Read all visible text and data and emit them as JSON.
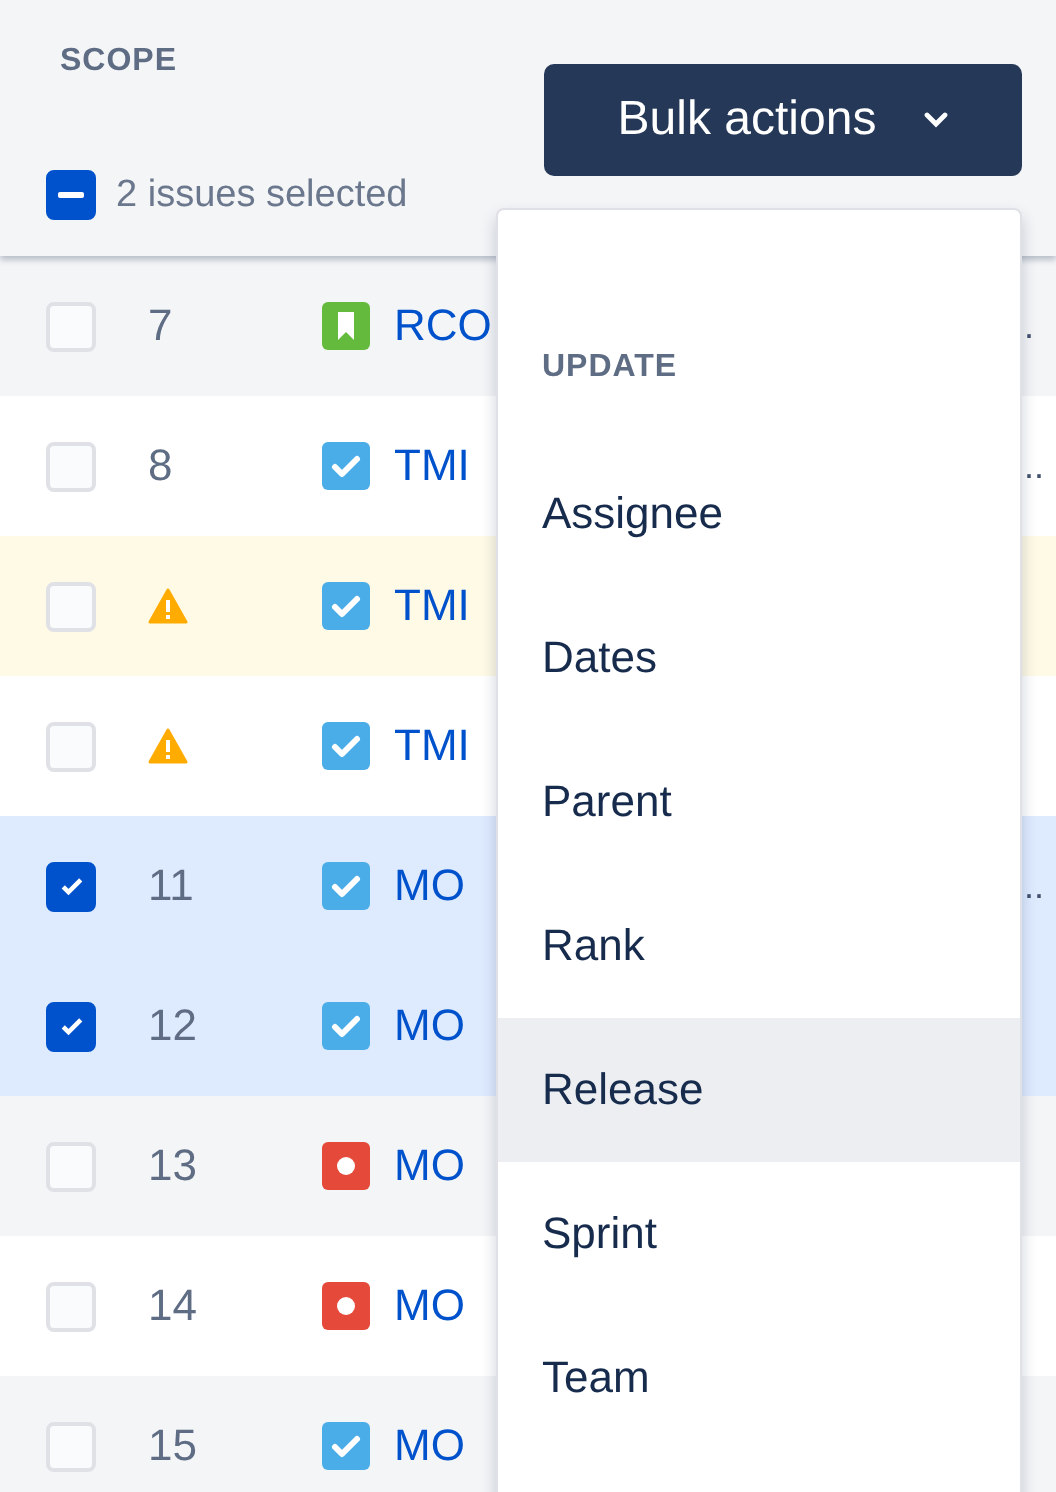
{
  "header": {
    "title": "SCOPE",
    "selection": {
      "label": "2 issues selected",
      "indeterminate": true
    },
    "bulk_button": {
      "label": "Bulk actions"
    }
  },
  "rows": [
    {
      "checked": false,
      "number": "7",
      "warning": false,
      "kind": "story",
      "key": "RCO",
      "highlighted": false,
      "overflow": "."
    },
    {
      "checked": false,
      "number": "8",
      "warning": false,
      "kind": "task",
      "key": "TMI",
      "highlighted": false,
      "overflow": ".."
    },
    {
      "checked": false,
      "warning": true,
      "kind": "task",
      "key": "TMI",
      "highlighted": true
    },
    {
      "checked": false,
      "warning": true,
      "kind": "task",
      "key": "TMI",
      "highlighted": false
    },
    {
      "checked": true,
      "number": "11",
      "warning": false,
      "kind": "task",
      "key": "MO",
      "overflow": ".."
    },
    {
      "checked": true,
      "number": "12",
      "warning": false,
      "kind": "task",
      "key": "MO"
    },
    {
      "checked": false,
      "number": "13",
      "warning": false,
      "kind": "bug",
      "key": "MO",
      "highlighted": false
    },
    {
      "checked": false,
      "number": "14",
      "warning": false,
      "kind": "bug",
      "key": "MO",
      "highlighted": false
    },
    {
      "checked": false,
      "number": "15",
      "warning": false,
      "kind": "task",
      "key": "MO",
      "highlighted": false
    }
  ],
  "menu": {
    "section": "UPDATE",
    "items": [
      {
        "label": "Assignee",
        "selected": false
      },
      {
        "label": "Dates",
        "selected": false
      },
      {
        "label": "Parent",
        "selected": false
      },
      {
        "label": "Rank",
        "selected": false
      },
      {
        "label": "Release",
        "selected": true
      },
      {
        "label": "Sprint",
        "selected": false
      },
      {
        "label": "Team",
        "selected": false
      }
    ]
  }
}
